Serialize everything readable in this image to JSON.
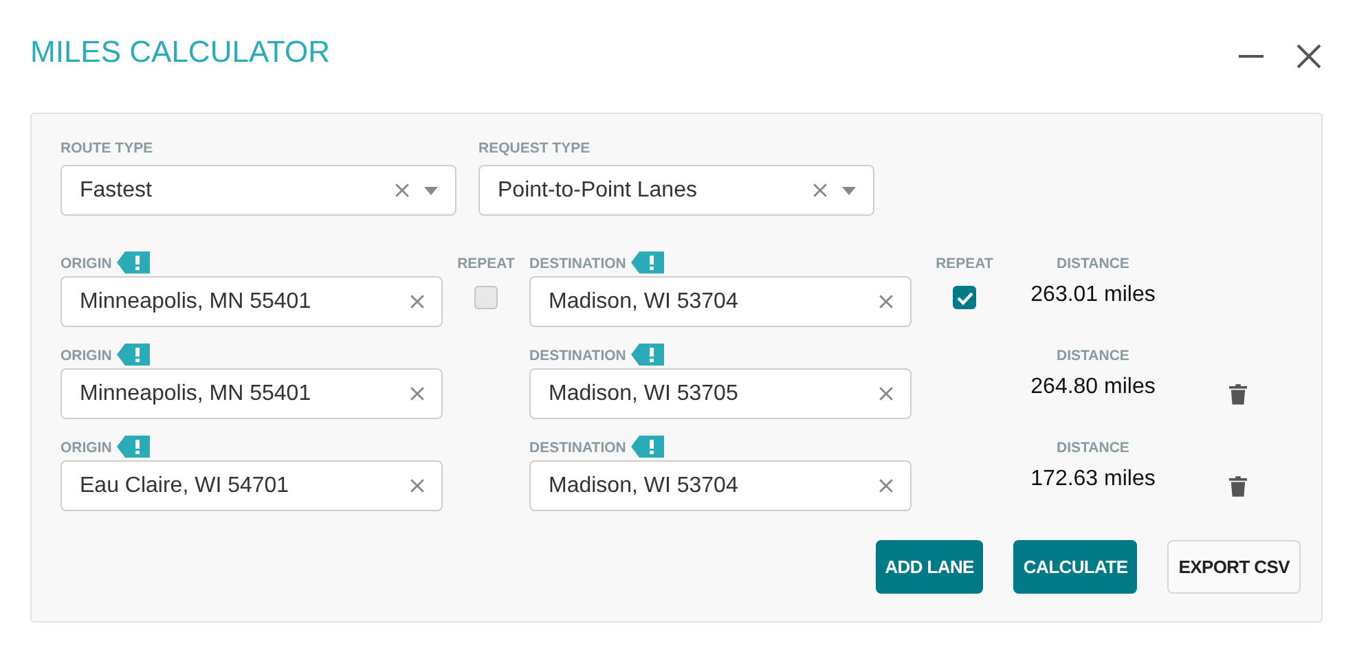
{
  "window": {
    "title": "MILES CALCULATOR"
  },
  "selects": [
    {
      "label": "ROUTE TYPE",
      "value": "Fastest"
    },
    {
      "label": "REQUEST TYPE",
      "value": "Point-to-Point Lanes"
    }
  ],
  "lanes": [
    {
      "origin_label": "ORIGIN",
      "origin": "Minneapolis, MN 55401",
      "origin_repeat": {
        "label": "REPEAT",
        "checked": false
      },
      "destination_label": "DESTINATION",
      "destination": "Madison, WI 53704",
      "destination_repeat": {
        "label": "REPEAT",
        "checked": true
      },
      "distance_label": "DISTANCE",
      "distance": "263.01 miles",
      "removable": false
    },
    {
      "origin_label": "ORIGIN",
      "origin": "Minneapolis, MN 55401",
      "destination_label": "DESTINATION",
      "destination": "Madison, WI 53705",
      "distance_label": "DISTANCE",
      "distance": "264.80 miles",
      "removable": true
    },
    {
      "origin_label": "ORIGIN",
      "origin": "Eau Claire, WI 54701",
      "destination_label": "DESTINATION",
      "destination": "Madison, WI 53704",
      "distance_label": "DISTANCE",
      "distance": "172.63 miles",
      "removable": true
    }
  ],
  "buttons": [
    {
      "label": "ADD LANE",
      "kind": "primary"
    },
    {
      "label": "CALCULATE",
      "kind": "primary"
    },
    {
      "label": "EXPORT CSV",
      "kind": "secondary"
    }
  ]
}
